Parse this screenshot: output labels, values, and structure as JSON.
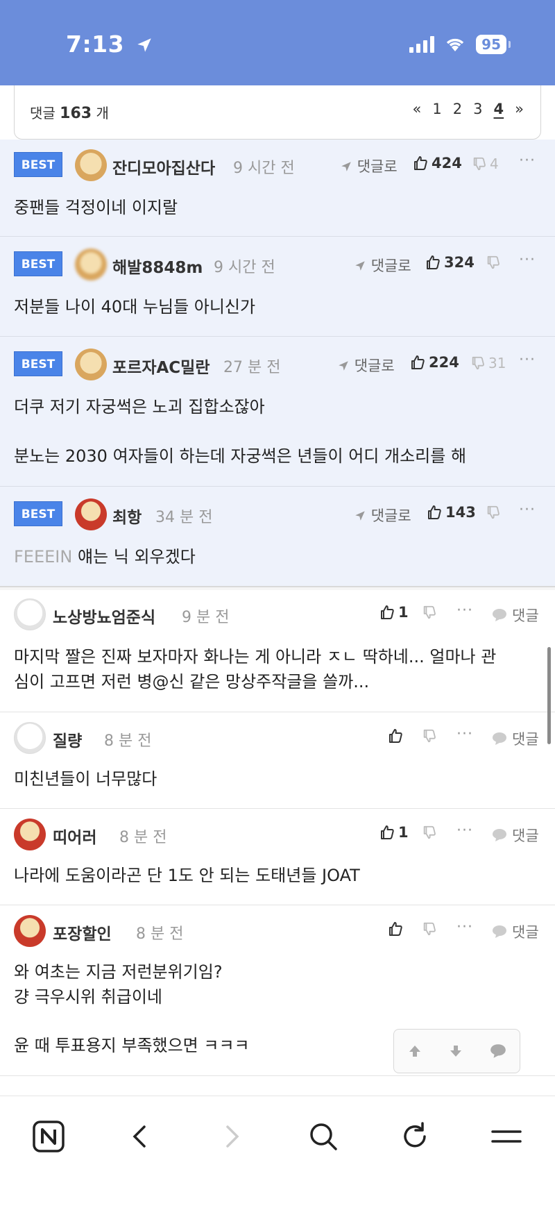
{
  "status": {
    "time": "7:13",
    "battery": "95"
  },
  "comments_header": {
    "label": "댓글",
    "count": "163",
    "unit": "개",
    "pager": {
      "first": "«",
      "pages": [
        "1",
        "2",
        "3",
        "4"
      ],
      "current": "4",
      "last": "»"
    }
  },
  "best_comments": [
    {
      "badge": "BEST",
      "nick": "잔디모아집산다",
      "time": "9 시간 전",
      "reply": "댓글로",
      "likes": "424",
      "dislikes": "4",
      "text": "중팬들 걱정이네 이지랄"
    },
    {
      "badge": "BEST",
      "nick": "해발8848m",
      "time": "9 시간 전",
      "reply": "댓글로",
      "likes": "324",
      "dislikes": "",
      "text": "저분들 나이 40대 누님들 아니신가"
    },
    {
      "badge": "BEST",
      "nick": "포르자AC밀란",
      "time": "27 분 전",
      "reply": "댓글로",
      "likes": "224",
      "dislikes": "31",
      "text_lines": [
        "더쿠 저기 자궁썩은 노괴 집합소잖아",
        "분노는 2030 여자들이 하는데 자궁썩은 년들이 어디 개소리를 해"
      ]
    },
    {
      "badge": "BEST",
      "nick": "최항",
      "time": "34 분 전",
      "reply": "댓글로",
      "likes": "143",
      "dislikes": "",
      "mention": "FEEEIN",
      "text": "얘는 닉 외우겠다"
    }
  ],
  "comments": [
    {
      "nick": "노상방뇨엄준식",
      "time": "9 분 전",
      "likes": "1",
      "reply": "댓글",
      "text_lines": [
        "마지막 짤은 진짜 보자마자 화나는 게 아니라 ㅈㄴ 딱하네... 얼마나 관",
        "심이 고프면 저런 병@신 같은 망상주작글을 쓸까..."
      ]
    },
    {
      "nick": "질량",
      "time": "8 분 전",
      "likes": "",
      "reply": "댓글",
      "text": "미친년들이 너무많다"
    },
    {
      "nick": "띠어러",
      "time": "8 분 전",
      "likes": "1",
      "reply": "댓글",
      "text": "나라에 도움이라곤 단 1도 안 되는 도태년들 JOAT"
    },
    {
      "nick": "포장할인",
      "time": "8 분 전",
      "likes": "",
      "reply": "댓글",
      "text_lines": [
        "와 여초는 지금 저런분위기임?",
        "걍 극우시위 취급이네",
        "윤 때 투표용지 부족했으면 ㅋㅋㅋ"
      ]
    }
  ],
  "more_label": "···",
  "float_nav": {
    "up": "up-arrow-icon",
    "down": "down-arrow-icon",
    "comment": "comment-icon"
  },
  "bottom_nav": [
    "naver-home-icon",
    "back-icon",
    "forward-icon",
    "search-icon",
    "reload-icon",
    "menu-icon"
  ],
  "colors": {
    "status_bar": "#6b8ddb",
    "best_badge": "#4a84e8",
    "best_bg": "#eef2fb"
  }
}
